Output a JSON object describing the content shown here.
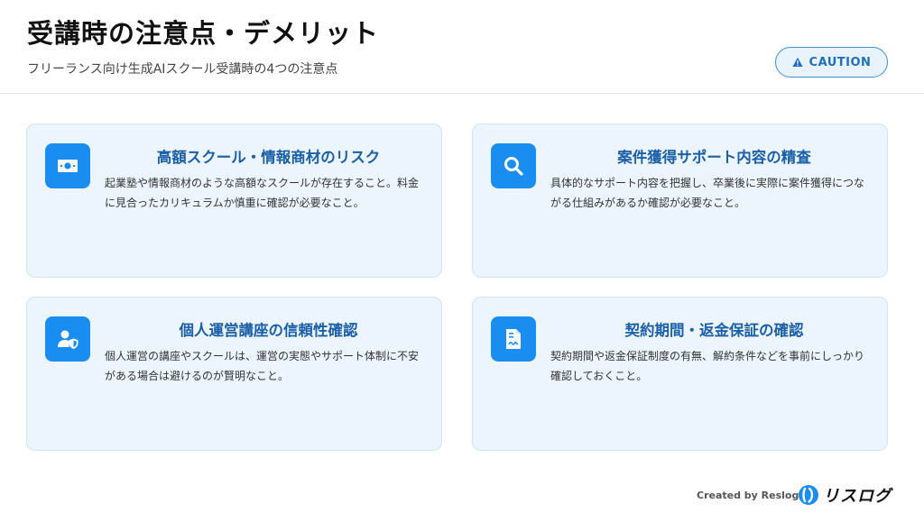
{
  "header": {
    "title": "受講時の注意点・デメリット",
    "subtitle": "フリーランス向け生成AIスクール受講時の4つの注意点",
    "badge": "CAUTION"
  },
  "cards": [
    {
      "icon": "money-bill-icon",
      "title": "高額スクール・情報商材のリスク",
      "body": "起業塾や情報商材のような高額なスクールが存在すること。料金に見合ったカリキュラムか慎重に確認が必要なこと。"
    },
    {
      "icon": "search-icon",
      "title": "案件獲得サポート内容の精査",
      "body": "具体的なサポート内容を把握し、卒業後に実際に案件獲得につながる仕組みがあるか確認が必要なこと。"
    },
    {
      "icon": "user-shield-icon",
      "title": "個人運営講座の信頼性確認",
      "body": "個人運営の講座やスクールは、運営の実態やサポート体制に不安がある場合は避けるのが賢明なこと。"
    },
    {
      "icon": "contract-document-icon",
      "title": "契約期間・返金保証の確認",
      "body": "契約期間や返金保証制度の有無、解約条件などを事前にしっかり確認しておくこと。"
    }
  ],
  "footer": {
    "credit": "Created by Reslog",
    "logo_text": "リスログ",
    "logo_icon": "reslog-logo-icon"
  },
  "colors": {
    "accent": "#1a8df0",
    "card_background": "#ecf5fd",
    "card_title": "#1a5fa8",
    "badge_text": "#1e6fc0"
  }
}
